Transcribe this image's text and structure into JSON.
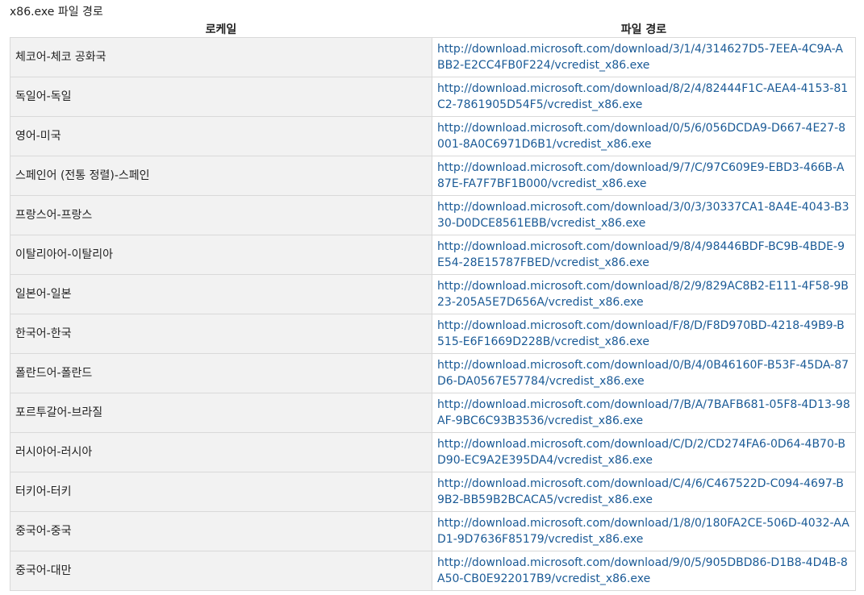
{
  "caption": "x86.exe 파일 경로",
  "table": {
    "headers": [
      "로케일",
      "파일 경로"
    ],
    "rows": [
      {
        "locale": "체코어-체코 공화국",
        "url": "http://download.microsoft.com/download/3/1/4/314627D5-7EEA-4C9A-ABB2-E2CC4FB0F224/vcredist_x86.exe"
      },
      {
        "locale": "독일어-독일",
        "url": "http://download.microsoft.com/download/8/2/4/82444F1C-AEA4-4153-81C2-7861905D54F5/vcredist_x86.exe"
      },
      {
        "locale": "영어-미국",
        "url": "http://download.microsoft.com/download/0/5/6/056DCDA9-D667-4E27-8001-8A0C6971D6B1/vcredist_x86.exe"
      },
      {
        "locale": "스페인어 (전통 정렬)-스페인",
        "url": "http://download.microsoft.com/download/9/7/C/97C609E9-EBD3-466B-A87E-FA7F7BF1B000/vcredist_x86.exe"
      },
      {
        "locale": "프랑스어-프랑스",
        "url": "http://download.microsoft.com/download/3/0/3/30337CA1-8A4E-4043-B330-D0DCE8561EBB/vcredist_x86.exe"
      },
      {
        "locale": "이탈리아어-이탈리아",
        "url": "http://download.microsoft.com/download/9/8/4/98446BDF-BC9B-4BDE-9E54-28E15787FBED/vcredist_x86.exe"
      },
      {
        "locale": "일본어-일본",
        "url": "http://download.microsoft.com/download/8/2/9/829AC8B2-E111-4F58-9B23-205A5E7D656A/vcredist_x86.exe"
      },
      {
        "locale": "한국어-한국",
        "url": "http://download.microsoft.com/download/F/8/D/F8D970BD-4218-49B9-B515-E6F1669D228B/vcredist_x86.exe"
      },
      {
        "locale": "폴란드어-폴란드",
        "url": "http://download.microsoft.com/download/0/B/4/0B46160F-B53F-45DA-87D6-DA0567E57784/vcredist_x86.exe"
      },
      {
        "locale": "포르투갈어-브라질",
        "url": "http://download.microsoft.com/download/7/B/A/7BAFB681-05F8-4D13-98AF-9BC6C93B3536/vcredist_x86.exe"
      },
      {
        "locale": "러시아어-러시아",
        "url": "http://download.microsoft.com/download/C/D/2/CD274FA6-0D64-4B70-BD90-EC9A2E395DA4/vcredist_x86.exe"
      },
      {
        "locale": "터키어-터키",
        "url": "http://download.microsoft.com/download/C/4/6/C467522D-C094-4697-B9B2-BB59B2BCACA5/vcredist_x86.exe"
      },
      {
        "locale": "중국어-중국",
        "url": "http://download.microsoft.com/download/1/8/0/180FA2CE-506D-4032-AAD1-9D7636F85179/vcredist_x86.exe"
      },
      {
        "locale": "중국어-대만",
        "url": "http://download.microsoft.com/download/9/0/5/905DBD86-D1B8-4D4B-8A50-CB0E922017B9/vcredist_x86.exe"
      }
    ]
  },
  "colors": {
    "link": "#1a5a96",
    "locale_cell_bg": "#f2f2f2",
    "border": "#d9d9d9"
  }
}
